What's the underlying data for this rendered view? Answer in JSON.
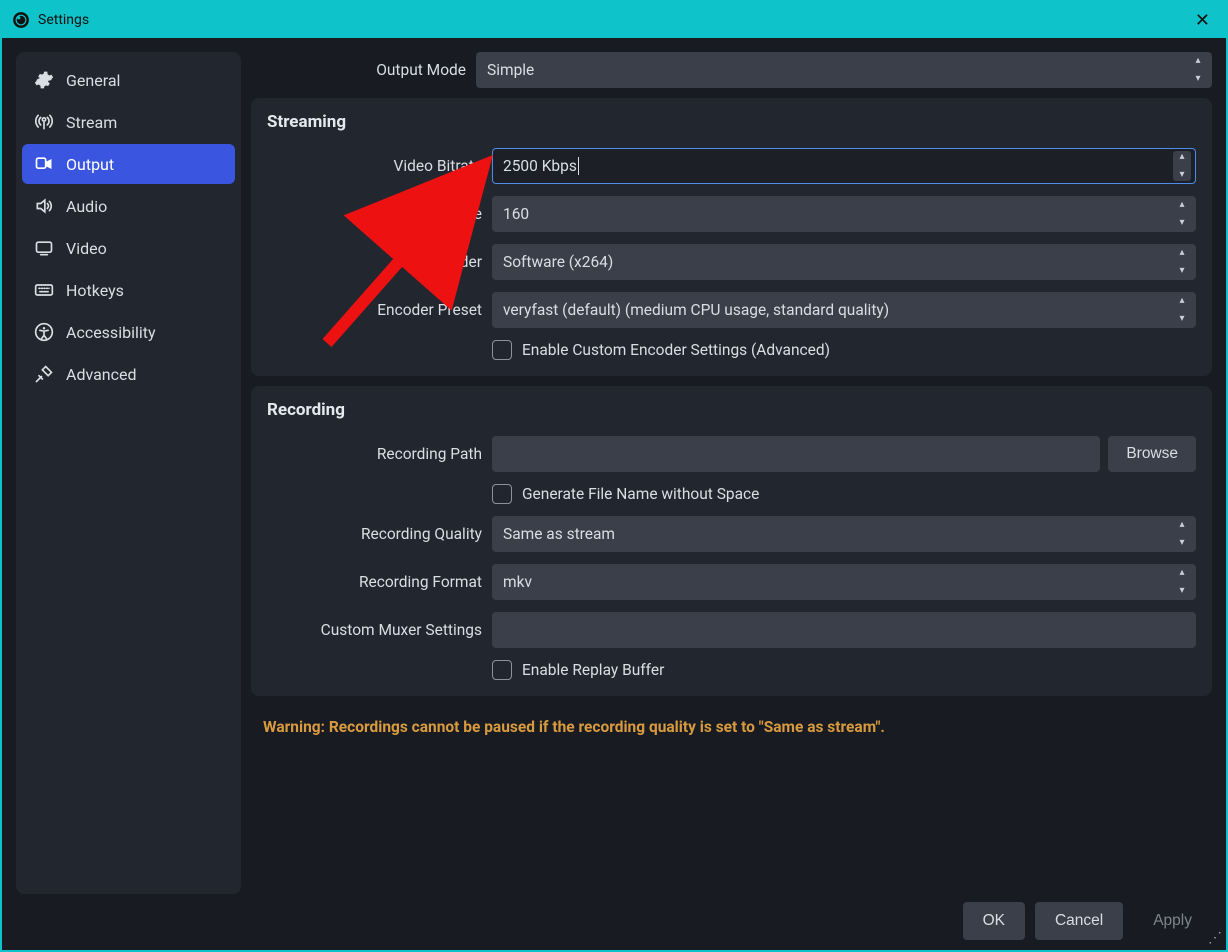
{
  "window": {
    "title": "Settings"
  },
  "sidebar": {
    "items": [
      {
        "label": "General"
      },
      {
        "label": "Stream"
      },
      {
        "label": "Output"
      },
      {
        "label": "Audio"
      },
      {
        "label": "Video"
      },
      {
        "label": "Hotkeys"
      },
      {
        "label": "Accessibility"
      },
      {
        "label": "Advanced"
      }
    ],
    "active_index": 2
  },
  "output_mode": {
    "label": "Output Mode",
    "value": "Simple"
  },
  "streaming": {
    "title": "Streaming",
    "video_bitrate": {
      "label": "Video Bitrate",
      "value": "2500 Kbps"
    },
    "audio_bitrate": {
      "label": "Audio Bitrate",
      "value": "160"
    },
    "encoder": {
      "label": "Encoder",
      "value": "Software (x264)"
    },
    "encoder_preset": {
      "label": "Encoder Preset",
      "value": "veryfast (default) (medium CPU usage, standard quality)"
    },
    "enable_custom": {
      "label": "Enable Custom Encoder Settings (Advanced)",
      "checked": false
    }
  },
  "recording": {
    "title": "Recording",
    "path": {
      "label": "Recording Path",
      "value": "",
      "browse": "Browse"
    },
    "gen_no_space": {
      "label": "Generate File Name without Space",
      "checked": false
    },
    "quality": {
      "label": "Recording Quality",
      "value": "Same as stream"
    },
    "format": {
      "label": "Recording Format",
      "value": "mkv"
    },
    "muxer": {
      "label": "Custom Muxer Settings",
      "value": ""
    },
    "replay_buffer": {
      "label": "Enable Replay Buffer",
      "checked": false
    }
  },
  "warning": "Warning: Recordings cannot be paused if the recording quality is set to \"Same as stream\".",
  "footer": {
    "ok": "OK",
    "cancel": "Cancel",
    "apply": "Apply"
  }
}
